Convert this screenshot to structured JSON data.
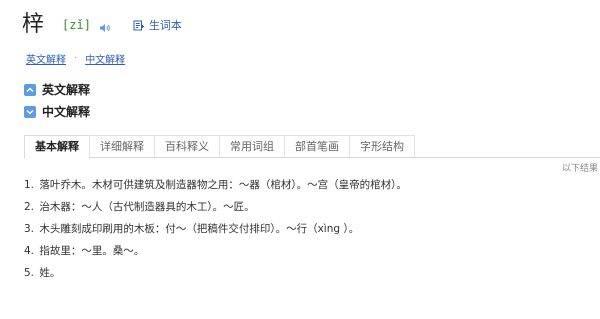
{
  "entry": {
    "word": "梓",
    "pinyin": "[zǐ]",
    "wordbook_label": "生词本"
  },
  "links": [
    {
      "label": "英文解释"
    },
    {
      "label": "中文解释"
    }
  ],
  "sections": [
    {
      "label": "英文解释"
    },
    {
      "label": "中文解释"
    }
  ],
  "tabs": [
    {
      "label": "基本解释",
      "active": true
    },
    {
      "label": "详细解释"
    },
    {
      "label": "百科释义"
    },
    {
      "label": "常用词组"
    },
    {
      "label": "部首笔画"
    },
    {
      "label": "字形结构"
    }
  ],
  "results_note": "以下结果",
  "definitions": [
    {
      "num": "1.",
      "text": "落叶乔木。木材可供建筑及制造器物之用：～器（棺材）。～宫（皇帝的棺材）。"
    },
    {
      "num": "2.",
      "text": "治木器：～人（古代制造器具的木工）。～匠。"
    },
    {
      "num": "3.",
      "text": "木头雕刻成印刷用的木板：付～（把稿件交付排印）。～行（xìng ）。"
    },
    {
      "num": "4.",
      "text": "指故里：～里。桑～。"
    },
    {
      "num": "5.",
      "text": "姓。"
    }
  ],
  "colors": {
    "link": "#2b62b5",
    "pinyin": "#3a8f2a",
    "section_box": "#5c9be6"
  }
}
